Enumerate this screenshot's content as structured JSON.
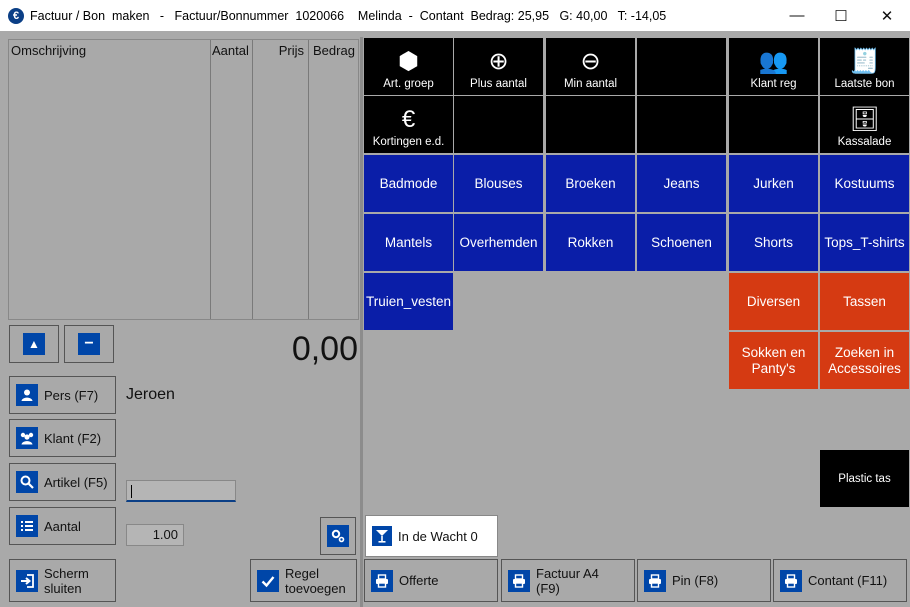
{
  "window": {
    "title": "Factuur / Bon  maken   -   Factuur/Bonnummer  1020066    Melinda  -  Contant  Bedrag: 25,95   G: 40,00   T: -14,05",
    "minimize": "—",
    "maximize": "☐",
    "close": "✕"
  },
  "table": {
    "headers": [
      "Omschrijving",
      "Aantal",
      "Prijs",
      "Bedrag"
    ]
  },
  "total": "0,00",
  "left_buttons": {
    "up_icon": "▲",
    "minus_icon": "−",
    "pers": "Pers (F7)",
    "klant": "Klant (F2)",
    "artikel": "Artikel (F5)",
    "aantal": "Aantal",
    "scherm_line1": "Scherm",
    "scherm_line2": "sluiten",
    "regel_line1": "Regel",
    "regel_line2": "toevoegen"
  },
  "pers_name": "Jeroen",
  "aantal_value": "1.00",
  "function_tiles": [
    {
      "label": "Art. groep",
      "icon": "⬢"
    },
    {
      "label": "Plus aantal",
      "icon": "⊕"
    },
    {
      "label": "Min aantal",
      "icon": "⊖"
    },
    {
      "label": "Klant reg",
      "icon": "👥"
    },
    {
      "label": "Laatste bon",
      "icon": "🧾"
    },
    {
      "label": "Kortingen e.d.",
      "icon": "€"
    },
    {
      "label": "Kassalade",
      "icon": "🗄"
    }
  ],
  "categories_blue": [
    "Badmode",
    "Blouses",
    "Broeken",
    "Jeans",
    "Jurken",
    "Kostuums",
    "Mantels",
    "Overhemden",
    "Rokken",
    "Schoenen",
    "Shorts",
    "Tops_T-shirts",
    "Truien_vesten"
  ],
  "categories_red": [
    {
      "line1": "Diversen",
      "line2": ""
    },
    {
      "line1": "Tassen",
      "line2": ""
    },
    {
      "line1": "Sokken en",
      "line2": "Panty's"
    },
    {
      "line1": "Zoeken in",
      "line2": "Accessoires"
    }
  ],
  "plastic_tas": "Plastic tas",
  "in_de_wacht": "In de Wacht 0",
  "bottom_buttons": {
    "offerte": "Offerte",
    "factuur_line1": "Factuur A4",
    "factuur_line2": "(F9)",
    "pin": "Pin (F8)",
    "contant": "Contant (F11)"
  },
  "colors": {
    "button_blue": "#0046a8",
    "category_blue": "#0a1ea8",
    "category_red": "#d53a12",
    "background": "#a9a9a9"
  }
}
